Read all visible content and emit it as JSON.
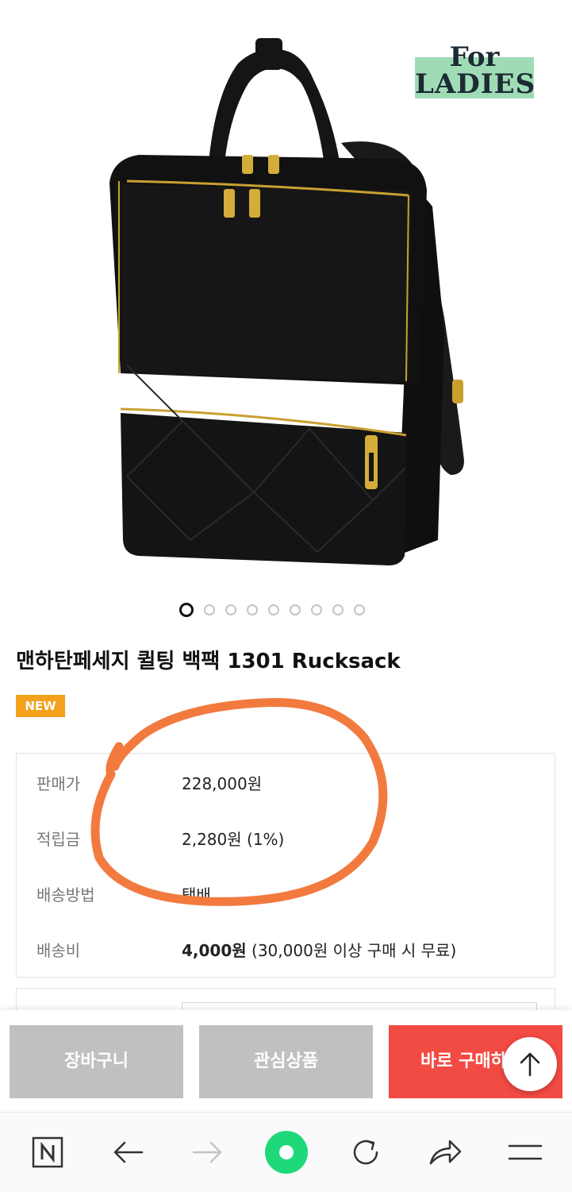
{
  "badge": {
    "line1": "For",
    "line2": "LADIES"
  },
  "carousel": {
    "count": 9,
    "active": 0
  },
  "product": {
    "title": "맨하탄페세지 퀼팅 백팩 1301 Rucksack",
    "new_label": "NEW"
  },
  "info": {
    "price_label": "판매가",
    "price_value": "228,000원",
    "points_label": "적립금",
    "points_value": "2,280원 (1%)",
    "shipping_method_label": "배송방법",
    "shipping_method_value": "택배",
    "shipping_fee_label": "배송비",
    "shipping_fee_amount": "4,000원",
    "shipping_fee_note": " (30,000원 이상 구매 시 무료)"
  },
  "actions": {
    "cart_label": "장바구니",
    "wishlist_label": "관심상품",
    "buy_label": "바로 구매하기"
  },
  "colors": {
    "accent_red": "#f24b43",
    "button_gray": "#c0c0c0",
    "new_badge": "#f3a01c",
    "annotation": "#f27a3f",
    "badge_green": "#9fdcb6",
    "nav_home_green": "#1ed97a"
  },
  "browser_nav": {
    "icons": [
      "naver-n-icon",
      "back-arrow-icon",
      "forward-arrow-icon",
      "home-icon",
      "refresh-icon",
      "share-icon",
      "menu-icon"
    ]
  }
}
